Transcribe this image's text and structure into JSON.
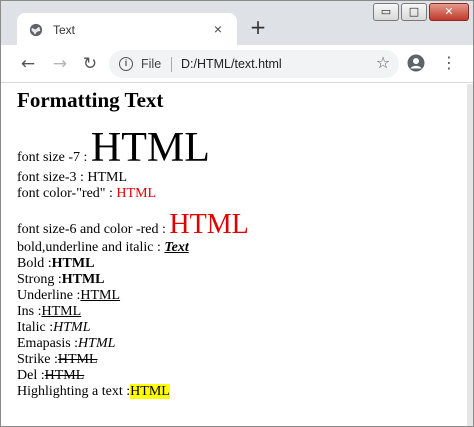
{
  "browser": {
    "tab_title": "Text",
    "new_tab_symbol": "+",
    "tab_close_symbol": "×",
    "omnibox": {
      "scheme_label": "File",
      "url": "D:/HTML/text.html"
    },
    "window_buttons": {
      "minimize": "▭",
      "maximize": "□",
      "close": "✕"
    }
  },
  "page": {
    "heading": "Formatting Text",
    "rows": [
      {
        "label": "font size -7 : ",
        "value": "HTML"
      },
      {
        "label": "font size-3 : ",
        "value": "HTML"
      },
      {
        "label": "font color-\"red\" : ",
        "value": "HTML"
      },
      {
        "label": "font size-6 and color -red : ",
        "value": "HTML"
      },
      {
        "label": "bold,underline and italic : ",
        "value": "Text"
      },
      {
        "label": "Bold :",
        "value": "HTML"
      },
      {
        "label": "Strong :",
        "value": "HTML"
      },
      {
        "label": "Underline :",
        "value": "HTML"
      },
      {
        "label": "Ins :",
        "value": "HTML"
      },
      {
        "label": "Italic :",
        "value": "HTML"
      },
      {
        "label": "Emapasis :",
        "value": "HTML"
      },
      {
        "label": "Strike :",
        "value": "HTML"
      },
      {
        "label": "Del :",
        "value": "HTML"
      },
      {
        "label": "Highlighting a text :",
        "value": "HTML"
      }
    ]
  },
  "colors": {
    "red": "#e00000",
    "highlight": "#ffff00"
  }
}
